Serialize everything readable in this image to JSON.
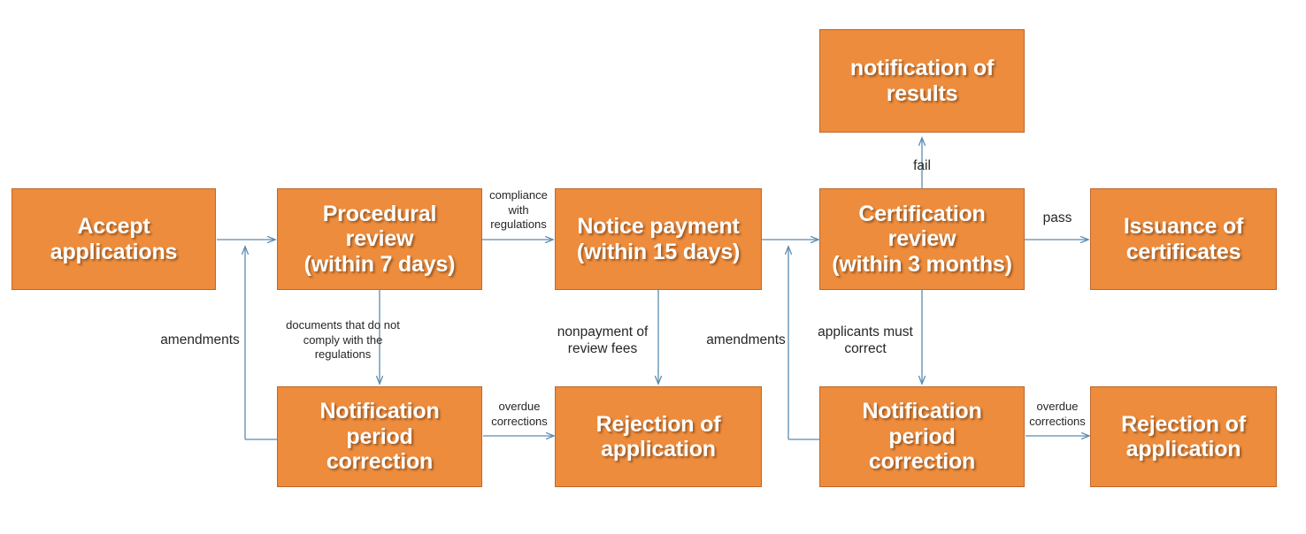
{
  "diagram": {
    "title": "Application Certification Process Flowchart",
    "colors": {
      "node_fill": "#ED8C3C",
      "node_border": "#C0662A",
      "node_text": "#FFFFFF",
      "edge_line": "#5B8CB0",
      "label_text": "#262626",
      "background": "#FFFFFF"
    },
    "nodes": [
      {
        "id": "accept",
        "label": "Accept\napplications"
      },
      {
        "id": "procedural",
        "label": "Procedural\nreview\n(within 7 days)"
      },
      {
        "id": "notice",
        "label": "Notice payment\n(within 15 days)"
      },
      {
        "id": "certification",
        "label": "Certification\nreview\n(within 3 months)"
      },
      {
        "id": "issuance",
        "label": "Issuance of\ncertificates"
      },
      {
        "id": "results",
        "label": "notification of\nresults"
      },
      {
        "id": "notify1",
        "label": "Notification\nperiod\ncorrection"
      },
      {
        "id": "reject1",
        "label": "Rejection of\napplication"
      },
      {
        "id": "notify2",
        "label": "Notification\nperiod\ncorrection"
      },
      {
        "id": "reject2",
        "label": "Rejection of\napplication"
      }
    ],
    "edge_labels": [
      {
        "id": "compliance",
        "text": "compliance\nwith\nregulations"
      },
      {
        "id": "pass",
        "text": "pass"
      },
      {
        "id": "fail",
        "text": "fail"
      },
      {
        "id": "amendments1",
        "text": "amendments"
      },
      {
        "id": "noncompliant",
        "text": "documents that  do not\ncomply with  the\nregulations"
      },
      {
        "id": "nonpayment",
        "text": "nonpayment of\nreview fees"
      },
      {
        "id": "amendments2",
        "text": "amendments"
      },
      {
        "id": "mustcorrect",
        "text": "applicants must\ncorrect"
      },
      {
        "id": "overdue1",
        "text": "overdue\ncorrections"
      },
      {
        "id": "overdue2",
        "text": "overdue\ncorrections"
      }
    ]
  }
}
